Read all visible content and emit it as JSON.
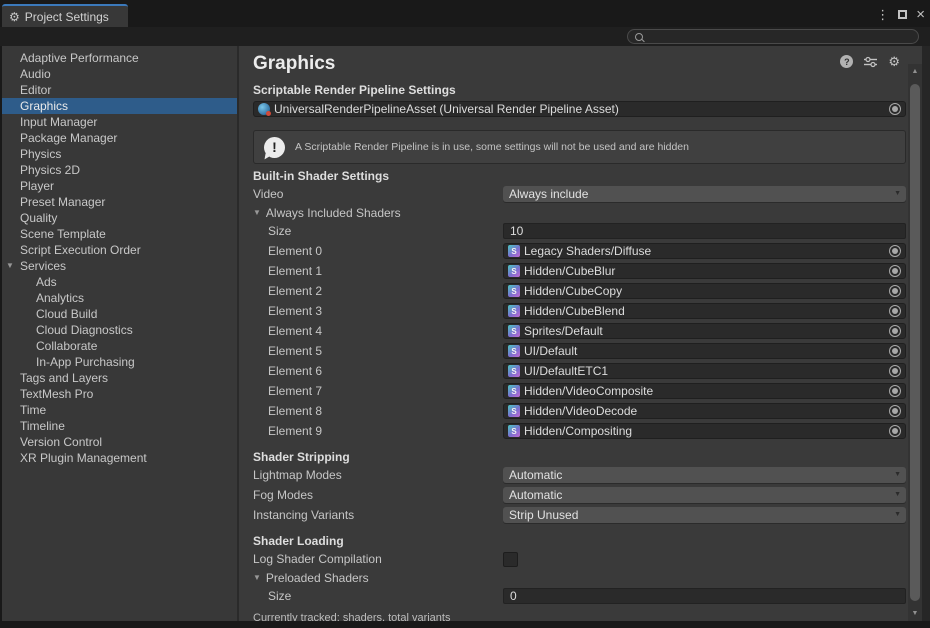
{
  "icons": {
    "gear": "⚙",
    "menu": "⋮",
    "close": "×",
    "help": "?",
    "foldout_open": "▼",
    "dropdown_arrow": "▼",
    "scroll_up": "▲",
    "scroll_down": "▼",
    "shader_letter": "S",
    "notice_exclamation": "!"
  },
  "window": {
    "tab_title": "Project Settings"
  },
  "search": {
    "value": ""
  },
  "sidebar": {
    "items": [
      {
        "label": "Adaptive Performance"
      },
      {
        "label": "Audio"
      },
      {
        "label": "Editor"
      },
      {
        "label": "Graphics",
        "selected": true
      },
      {
        "label": "Input Manager"
      },
      {
        "label": "Package Manager"
      },
      {
        "label": "Physics"
      },
      {
        "label": "Physics 2D"
      },
      {
        "label": "Player"
      },
      {
        "label": "Preset Manager"
      },
      {
        "label": "Quality"
      },
      {
        "label": "Scene Template"
      },
      {
        "label": "Script Execution Order"
      },
      {
        "label": "Services",
        "foldout": true
      },
      {
        "label": "Ads",
        "child": true
      },
      {
        "label": "Analytics",
        "child": true
      },
      {
        "label": "Cloud Build",
        "child": true
      },
      {
        "label": "Cloud Diagnostics",
        "child": true
      },
      {
        "label": "Collaborate",
        "child": true
      },
      {
        "label": "In-App Purchasing",
        "child": true
      },
      {
        "label": "Tags and Layers"
      },
      {
        "label": "TextMesh Pro"
      },
      {
        "label": "Time"
      },
      {
        "label": "Timeline"
      },
      {
        "label": "Version Control"
      },
      {
        "label": "XR Plugin Management"
      }
    ]
  },
  "main": {
    "title": "Graphics",
    "srp": {
      "heading": "Scriptable Render Pipeline Settings",
      "value": "UniversalRenderPipelineAsset (Universal Render Pipeline Asset)"
    },
    "notice": "A Scriptable Render Pipeline is in use, some settings will not be used and are hidden",
    "builtin_heading": "Built-in Shader Settings",
    "video": {
      "label": "Video",
      "value": "Always include"
    },
    "always_included": {
      "label": "Always Included Shaders",
      "size_label": "Size",
      "size_value": "10",
      "elements": [
        {
          "label": "Element 0",
          "value": "Legacy Shaders/Diffuse"
        },
        {
          "label": "Element 1",
          "value": "Hidden/CubeBlur"
        },
        {
          "label": "Element 2",
          "value": "Hidden/CubeCopy"
        },
        {
          "label": "Element 3",
          "value": "Hidden/CubeBlend"
        },
        {
          "label": "Element 4",
          "value": "Sprites/Default"
        },
        {
          "label": "Element 5",
          "value": "UI/Default"
        },
        {
          "label": "Element 6",
          "value": "UI/DefaultETC1"
        },
        {
          "label": "Element 7",
          "value": "Hidden/VideoComposite"
        },
        {
          "label": "Element 8",
          "value": "Hidden/VideoDecode"
        },
        {
          "label": "Element 9",
          "value": "Hidden/Compositing"
        }
      ]
    },
    "stripping": {
      "heading": "Shader Stripping",
      "rows": [
        {
          "label": "Lightmap Modes",
          "value": "Automatic"
        },
        {
          "label": "Fog Modes",
          "value": "Automatic"
        },
        {
          "label": "Instancing Variants",
          "value": "Strip Unused"
        }
      ]
    },
    "loading": {
      "heading": "Shader Loading",
      "log_label": "Log Shader Compilation",
      "preloaded_label": "Preloaded Shaders",
      "size_label": "Size",
      "size_value": "0",
      "tracked_info": "Currently tracked: shaders, total variants"
    }
  }
}
